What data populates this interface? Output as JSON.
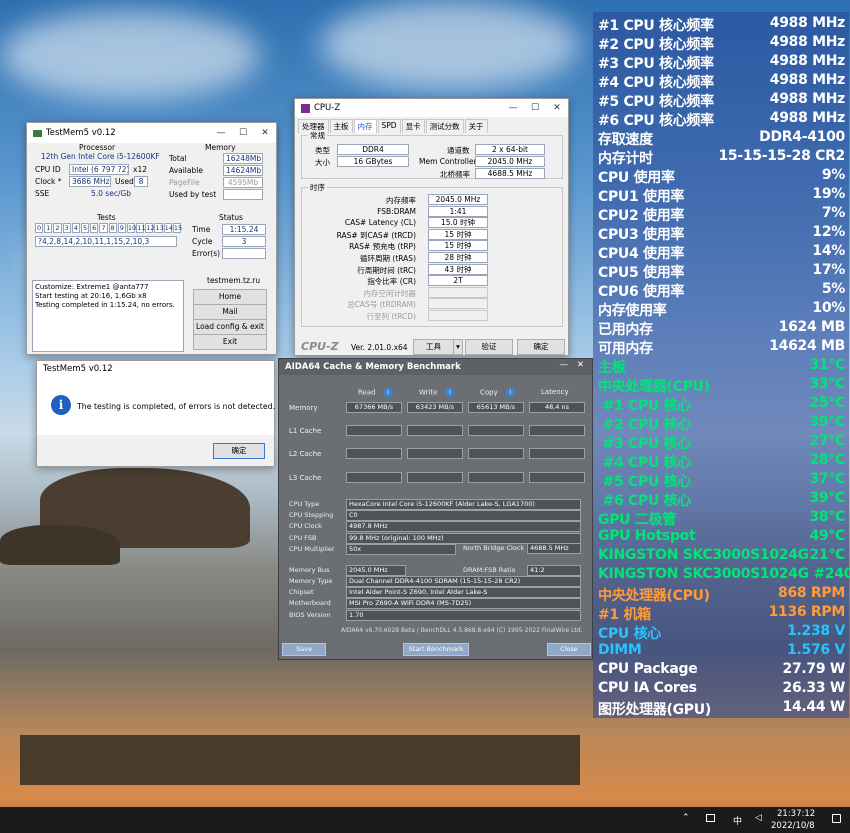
{
  "colors": {
    "osd_white": "#ffffff",
    "osd_orange": "#ff9b3a",
    "osd_green": "#00e676",
    "osd_cyan": "#28c4ff",
    "aida_button": "#8fa9c6"
  },
  "testmem": {
    "title": "TestMem5 v0.12",
    "processor_label": "Processor",
    "processor": "12th Gen Intel Core i5-12600KF",
    "cpuid_label": "CPU ID",
    "cpuid": "Intel (6 797 ?2)",
    "threads": "x12",
    "clock_label": "Clock *",
    "clock": "3686 MHz",
    "used_label": "Used",
    "used": "8",
    "sse_label": "SSE",
    "sse": "5.0 sec/Gb",
    "memory_label": "Memory",
    "total_label": "Total",
    "total": "16248Mb",
    "available_label": "Available",
    "available": "14624Mb",
    "pagefile_label": "PageFile",
    "pagefile": "4595Mb",
    "usedbytest_label": "Used by test",
    "usedbytest": "",
    "tests_label": "Tests",
    "tests_nums": [
      "0",
      "1",
      "2",
      "3",
      "4",
      "5",
      "6",
      "7",
      "8",
      "9",
      "10",
      "11",
      "12",
      "13",
      "14",
      "15"
    ],
    "tests_seq": "?4,2,8,14,2,10,11,1,15,2,10,3",
    "status_label": "Status",
    "time_label": "Time",
    "time": "1:15.24",
    "cycle_label": "Cycle",
    "cycle": "3",
    "errors_label": "Error(s)",
    "errors": "",
    "log": [
      "Customize: Extreme1 @anta777",
      "Start testing at 20:16, 1.6Gb x8",
      "Testing completed in 1:15.24, no errors."
    ],
    "site": "testmem.tz.ru",
    "btn_home": "Home",
    "btn_mail": "Mail",
    "btn_load": "Load config & exit",
    "btn_exit": "Exit"
  },
  "dialog": {
    "title": "TestMem5 v0.12",
    "message": "The testing is completed, of errors is not detected.",
    "ok": "确定"
  },
  "cpuz": {
    "title": "CPU-Z",
    "tabs": [
      "处理器",
      "主板",
      "内存",
      "SPD",
      "显卡",
      "测试分数",
      "关于"
    ],
    "general_label": "常规",
    "type_label": "类型",
    "type": "DDR4",
    "channels_label": "通道数",
    "channels": "2 x 64-bit",
    "size_label": "大小",
    "size": "16 GBytes",
    "memctrl_label": "Mem Controller",
    "memctrl": "2045.0 MHz",
    "nb_label": "北桥频率",
    "nb": "4688.5 MHz",
    "timing_label": "时序",
    "timings": [
      {
        "label": "内存频率",
        "value": "2045.0 MHz"
      },
      {
        "label": "FSB:DRAM",
        "value": "1:41"
      },
      {
        "label": "CAS# Latency (CL)",
        "value": "15.0 时钟"
      },
      {
        "label": "RAS# 到CAS# (tRCD)",
        "value": "15 时钟"
      },
      {
        "label": "RAS# 预充电 (tRP)",
        "value": "15 时钟"
      },
      {
        "label": "循环周期 (tRAS)",
        "value": "28 时钟"
      },
      {
        "label": "行周期时间 (tRC)",
        "value": "43 时钟"
      },
      {
        "label": "指令比率 (CR)",
        "value": "2T"
      },
      {
        "label": "内存空闲计时器",
        "value": ""
      },
      {
        "label": "总CAS号 (tRDRAM)",
        "value": ""
      },
      {
        "label": "行至列 (tRCD)",
        "value": ""
      }
    ],
    "logo": "CPU-Z",
    "version": "Ver. 2.01.0.x64",
    "tools": "工具",
    "validate": "验证",
    "ok": "确定"
  },
  "aida": {
    "title": "AIDA64 Cache & Memory Benchmark",
    "cols": [
      "Read",
      "Write",
      "Copy",
      "Latency"
    ],
    "rows": [
      {
        "label": "Memory",
        "values": [
          "67366 MB/s",
          "63423 MB/s",
          "65613 MB/s",
          "48.4 ns"
        ]
      },
      {
        "label": "L1 Cache",
        "values": [
          "",
          "",
          "",
          ""
        ]
      },
      {
        "label": "L2 Cache",
        "values": [
          "",
          "",
          "",
          ""
        ]
      },
      {
        "label": "L3 Cache",
        "values": [
          "",
          "",
          "",
          ""
        ]
      }
    ],
    "info": [
      {
        "label": "CPU Type",
        "value": "HexaCore Intel Core i5-12600KF (Alder Lake-S, LGA1700)"
      },
      {
        "label": "CPU Stepping",
        "value": "C0"
      },
      {
        "label": "CPU Clock",
        "value": "4987.8 MHz"
      },
      {
        "label": "CPU FSB",
        "value": "99.8 MHz (original: 100 MHz)"
      },
      {
        "label": "CPU Multiplier",
        "value": "50x"
      }
    ],
    "nbclock_label": "North Bridge Clock",
    "nbclock": "4688.5 MHz",
    "membus_label": "Memory Bus",
    "membus": "2045.0 MHz",
    "ratio_label": "DRAM:FSB Ratio",
    "ratio": "41:2",
    "info2": [
      {
        "label": "Memory Type",
        "value": "Dual Channel DDR4-4100 SDRAM (15-15-15-28 CR2)"
      },
      {
        "label": "Chipset",
        "value": "Intel Alder Point-S Z690, Intel Alder Lake-S"
      },
      {
        "label": "Motherboard",
        "value": "MSI Pro Z690-A WiFi DDR4 (MS-7D25)"
      },
      {
        "label": "BIOS Version",
        "value": "1.70"
      }
    ],
    "footer": "AIDA64 v6.70.6028 Beta / BenchDLL 4.5.868.8-x64 (C) 1995-2022 FinalWire Ltd.",
    "save": "Save",
    "start": "Start Benchmark",
    "close": "Close"
  },
  "osd": [
    {
      "label": "#1 CPU 核心频率",
      "value": "4988 MHz",
      "color": "white"
    },
    {
      "label": "#2 CPU 核心频率",
      "value": "4988 MHz",
      "color": "white"
    },
    {
      "label": "#3 CPU 核心频率",
      "value": "4988 MHz",
      "color": "white"
    },
    {
      "label": "#4 CPU 核心频率",
      "value": "4988 MHz",
      "color": "white"
    },
    {
      "label": "#5 CPU 核心频率",
      "value": "4988 MHz",
      "color": "white"
    },
    {
      "label": "#6 CPU 核心频率",
      "value": "4988 MHz",
      "color": "white"
    },
    {
      "label": "存取速度",
      "value": "DDR4-4100",
      "color": "white"
    },
    {
      "label": "内存计时",
      "value": "15-15-15-28 CR2",
      "color": "white"
    },
    {
      "label": "CPU 使用率",
      "value": "9%",
      "color": "white"
    },
    {
      "label": "CPU1 使用率",
      "value": "19%",
      "color": "white"
    },
    {
      "label": "CPU2 使用率",
      "value": "7%",
      "color": "white"
    },
    {
      "label": "CPU3 使用率",
      "value": "12%",
      "color": "white"
    },
    {
      "label": "CPU4 使用率",
      "value": "14%",
      "color": "white"
    },
    {
      "label": "CPU5 使用率",
      "value": "17%",
      "color": "white"
    },
    {
      "label": "CPU6 使用率",
      "value": "5%",
      "color": "white"
    },
    {
      "label": "内存使用率",
      "value": "10%",
      "color": "white"
    },
    {
      "label": "已用内存",
      "value": "1624 MB",
      "color": "white"
    },
    {
      "label": "可用内存",
      "value": "14624 MB",
      "color": "white"
    },
    {
      "label": "主板",
      "value": "31°C",
      "color": "green"
    },
    {
      "label": "中央处理器(CPU)",
      "value": "33°C",
      "color": "green"
    },
    {
      "label": " #1 CPU 核心",
      "value": "25°C",
      "color": "green"
    },
    {
      "label": " #2 CPU 核心",
      "value": "39°C",
      "color": "green"
    },
    {
      "label": " #3 CPU 核心",
      "value": "27°C",
      "color": "green"
    },
    {
      "label": " #4 CPU 核心",
      "value": "28°C",
      "color": "green"
    },
    {
      "label": " #5 CPU 核心",
      "value": "37°C",
      "color": "green"
    },
    {
      "label": " #6 CPU 核心",
      "value": "39°C",
      "color": "green"
    },
    {
      "label": "GPU 二极管",
      "value": "38°C",
      "color": "green"
    },
    {
      "label": "GPU Hotspot",
      "value": "49°C",
      "color": "green"
    },
    {
      "label": "KINGSTON SKC3000S1024G",
      "value": "21°C",
      "color": "green"
    },
    {
      "label": "KINGSTON SKC3000S1024G #2",
      "value": "40°C",
      "color": "green"
    },
    {
      "label": "中央处理器(CPU)",
      "value": "868 RPM",
      "color": "orange"
    },
    {
      "label": "#1 机箱",
      "value": "1136 RPM",
      "color": "orange"
    },
    {
      "label": "CPU 核心",
      "value": "1.238 V",
      "color": "cyan"
    },
    {
      "label": "DIMM",
      "value": "1.576 V",
      "color": "cyan"
    },
    {
      "label": "CPU Package",
      "value": "27.79 W",
      "color": "white"
    },
    {
      "label": "CPU IA Cores",
      "value": "26.33 W",
      "color": "white"
    },
    {
      "label": "图形处理器(GPU)",
      "value": "14.44 W",
      "color": "white"
    }
  ],
  "taskbar": {
    "time": "21:37:12",
    "date": "2022/10/8",
    "ime": "中"
  }
}
